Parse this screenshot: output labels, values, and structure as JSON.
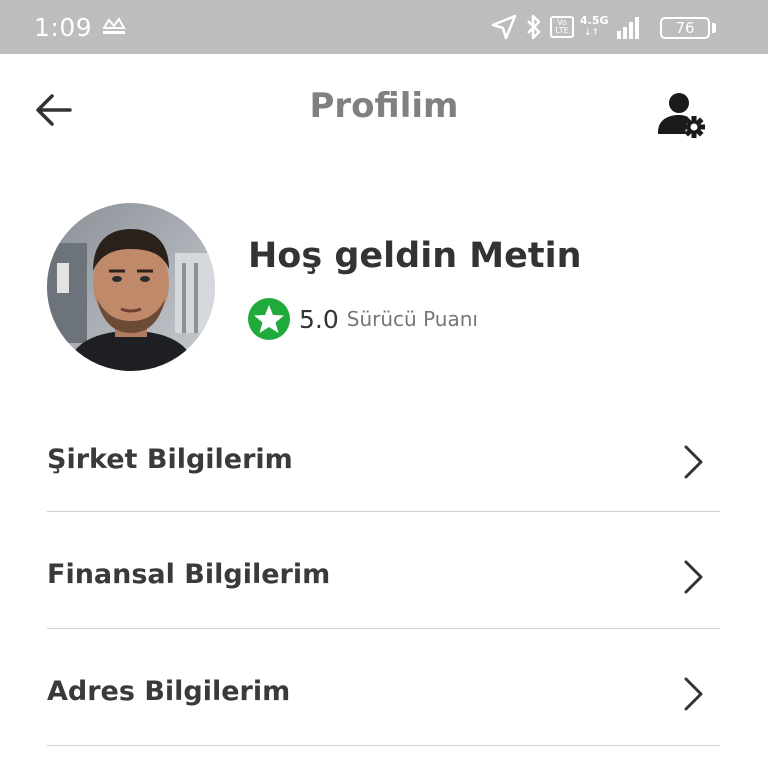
{
  "status_bar": {
    "time": "1:09",
    "notification_icon": "app-notification-icon",
    "network_type": "4.5G",
    "volte_label": "Vo LTE",
    "battery_level": "76"
  },
  "header": {
    "title": "Profilim",
    "back_icon": "arrow-left-icon",
    "settings_icon": "user-settings-icon"
  },
  "profile": {
    "welcome_text": "Hoş geldin Metin",
    "rating_value": "5.0",
    "rating_label": "Sürücü Puanı",
    "rating_icon": "star-badge-icon",
    "rating_color": "#1faa3b"
  },
  "menu": {
    "items": [
      {
        "label": "Şirket Bilgilerim"
      },
      {
        "label": "Finansal Bilgilerim"
      },
      {
        "label": "Adres Bilgilerim"
      }
    ]
  },
  "colors": {
    "status_bar_bg": "#bdbdbd",
    "title": "#808080",
    "text": "#333333",
    "divider": "#cfcfcf"
  }
}
